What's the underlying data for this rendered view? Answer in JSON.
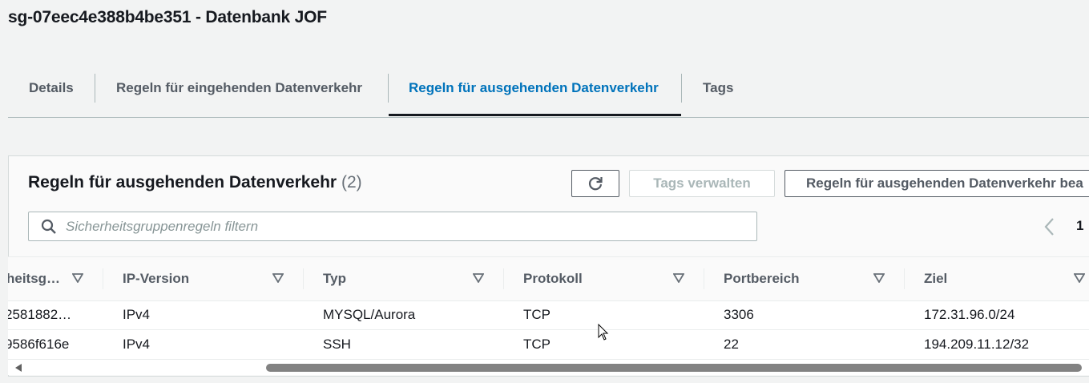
{
  "page": {
    "title": "sg-07eec4e388b4be351 - Datenbank JOF"
  },
  "tabs": [
    {
      "label": "Details",
      "active": false
    },
    {
      "label": "Regeln für eingehenden Datenverkehr",
      "active": false
    },
    {
      "label": "Regeln für ausgehenden Datenverkehr",
      "active": true
    },
    {
      "label": "Tags",
      "active": false
    }
  ],
  "panel": {
    "title": "Regeln für ausgehenden Datenverkehr",
    "count": "(2)",
    "refresh_icon": "refresh-icon",
    "manage_tags_label": "Tags verwalten",
    "edit_rules_label": "Regeln für ausgehenden Datenverkehr bea",
    "search_placeholder": "Sicherheitsgruppenregeln filtern",
    "search_value": "",
    "page_number": "1"
  },
  "table": {
    "columns": [
      "heitsg…",
      "IP-Version",
      "Typ",
      "Protokoll",
      "Portbereich",
      "Ziel"
    ],
    "rows": [
      [
        "2581882…",
        "IPv4",
        "MYSQL/Aurora",
        "TCP",
        "3306",
        "172.31.96.0/24"
      ],
      [
        "9586f616e",
        "IPv4",
        "SSH",
        "TCP",
        "22",
        "194.209.11.12/32"
      ]
    ]
  },
  "colors": {
    "accent": "#0073bb",
    "text": "#16191f",
    "muted": "#545b64",
    "background": "#f2f3f3"
  }
}
